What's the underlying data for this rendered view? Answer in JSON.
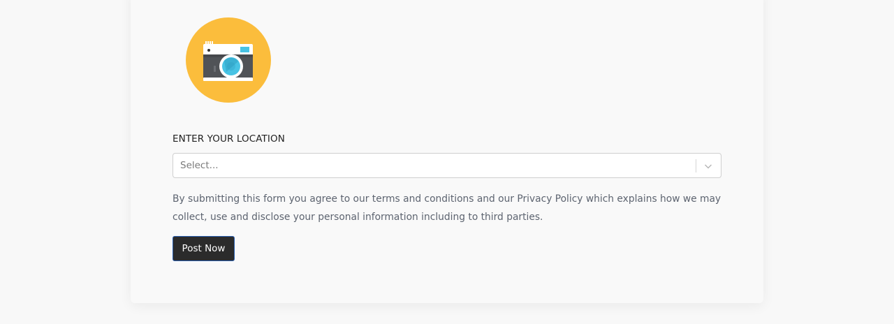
{
  "upload": {
    "icon": "camera-icon",
    "circle_color": "#fbbd3c"
  },
  "location": {
    "label": "ENTER YOUR LOCATION",
    "placeholder": "Select...",
    "dropdown_icon": "chevron-down-icon"
  },
  "legal": {
    "text": "By submitting this form you agree to our terms and conditions and our Privacy Policy which explains how we may collect, use and disclose your personal information including to third parties."
  },
  "actions": {
    "post_label": "Post Now",
    "post_color": "#2b2b2b"
  }
}
